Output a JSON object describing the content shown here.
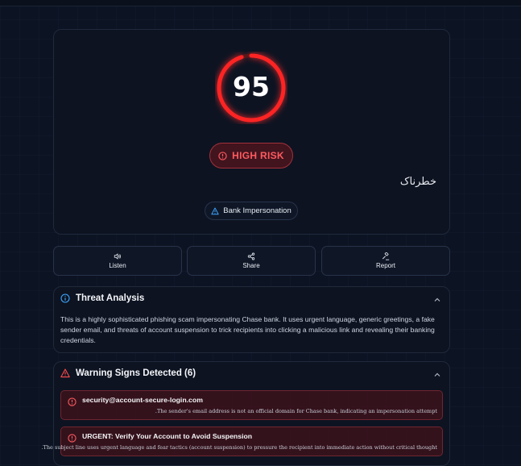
{
  "score": {
    "value": "95",
    "level": 0.95
  },
  "risk": {
    "label": "HIGH RISK",
    "translation": "خطرناک"
  },
  "scam_type": {
    "label": "Bank Impersonation"
  },
  "actions": [
    {
      "label": "Listen",
      "icon": "speaker-icon"
    },
    {
      "label": "Share",
      "icon": "share-icon"
    },
    {
      "label": "Report",
      "icon": "gavel-icon"
    }
  ],
  "threat_analysis": {
    "title": "Threat Analysis",
    "text": "This is a highly sophisticated phishing scam impersonating Chase bank. It uses urgent language, generic greetings, a fake sender email, and threats of account suspension to trick recipients into clicking a malicious link and revealing their banking credentials."
  },
  "warnings": {
    "title": "Warning Signs Detected (6)",
    "items": [
      {
        "title": "security@account-secure-login.com",
        "detail": ".The sender's email address is not an official domain for Chase bank, indicating an impersonation attempt"
      },
      {
        "title": "URGENT: Verify Your Account to Avoid Suspension",
        "detail": ".The subject line uses urgent language and fear tactics (account suspension) to pressure the recipient into immediate action without critical thought"
      }
    ]
  },
  "colors": {
    "danger": "#ff3b3b",
    "info": "#3ea6ff",
    "background": "#0c1322"
  }
}
